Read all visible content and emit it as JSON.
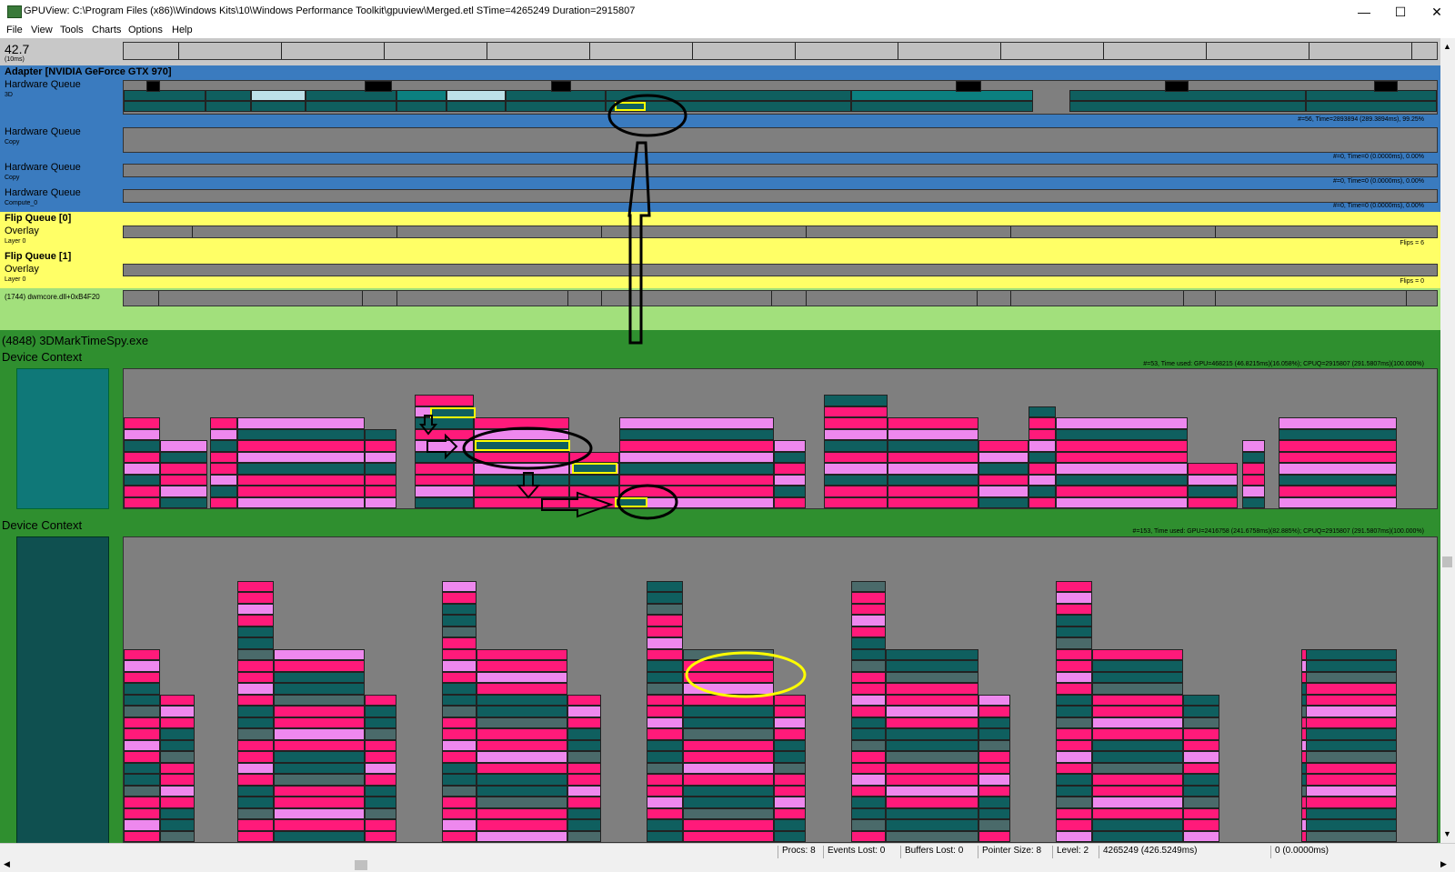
{
  "window": {
    "title": "GPUView: C:\\Program Files (x86)\\Windows Kits\\10\\Windows Performance Toolkit\\gpuview\\Merged.etl STime=4265249 Duration=2915807",
    "minimize": "—",
    "maximize": "☐",
    "close": "✕"
  },
  "menu": [
    "File",
    "View",
    "Tools",
    "Charts",
    "Options",
    "Help"
  ],
  "ruler": {
    "value": "42.7",
    "unit": "(10ms)"
  },
  "adapter": {
    "title": "Adapter [NVIDIA GeForce GTX 970]",
    "queues": [
      {
        "label": "Hardware Queue",
        "sub": "3D",
        "stats": "#=56,  Time=2893894 (289.3894ms),  99.25%"
      },
      {
        "label": "Hardware Queue",
        "sub": "Copy",
        "stats": "#=0,  Time=0 (0.0000ms),  0.00%"
      },
      {
        "label": "Hardware Queue",
        "sub": "Copy",
        "stats": "#=0,  Time=0 (0.0000ms),  0.00%"
      },
      {
        "label": "Hardware Queue",
        "sub": "Compute_0",
        "stats": "#=0,  Time=0 (0.0000ms),  0.00%"
      }
    ]
  },
  "flip_queues": [
    {
      "title": "Flip Queue [0]",
      "label": "Overlay",
      "sub": "Layer 0",
      "stats": "Flips = 6"
    },
    {
      "title": "Flip Queue [1]",
      "label": "Overlay",
      "sub": "Layer 0",
      "stats": "Flips = 0"
    }
  ],
  "dwm": {
    "label": "(1744) dwmcore.dll+0xB4F20"
  },
  "process": {
    "title": "(4848) 3DMarkTimeSpy.exe",
    "contexts": [
      {
        "label": "Device Context",
        "stats": "#=53, Time used: GPU=468215 (46.8215ms)(16.058%); CPUQ=2915807 (291.5807ms)(100.000%)"
      },
      {
        "label": "Device Context",
        "stats": "#=153, Time used: GPU=2416758 (241.6758ms)(82.885%); CPUQ=2915807 (291.5807ms)(100.000%)"
      }
    ]
  },
  "status": {
    "procs": "Procs: 8",
    "events_lost": "Events Lost: 0",
    "buffers_lost": "Buffers Lost: 0",
    "pointer_size": "Pointer Size: 8",
    "level": "Level: 2",
    "time": "4265249 (426.5249ms)",
    "sel": "0 (0.0000ms)"
  },
  "colors": {
    "adapter_bg": "#3a7bbf",
    "flip_bg": "#ffff66",
    "dwm_bg": "#a2e07c",
    "process_bg": "#2f8f2f",
    "track_gray": "#7f7f7f",
    "packet_magenta": "#ff1a7a",
    "packet_teal": "#0f5f5f",
    "packet_pink": "#ee88ee",
    "highlight_yellow": "#ffff00"
  }
}
